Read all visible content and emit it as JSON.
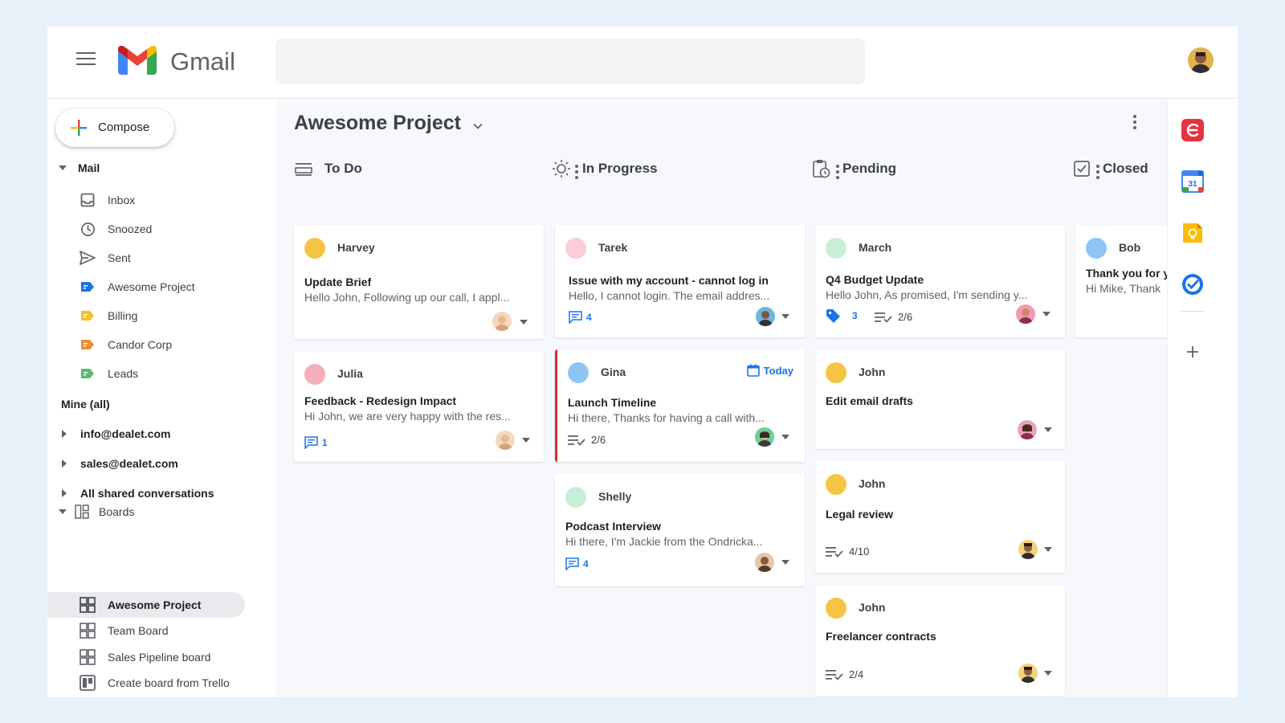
{
  "app": {
    "name": "Gmail"
  },
  "compose": {
    "label": "Compose"
  },
  "sidebar": {
    "mail_header": "Mail",
    "mail_items": [
      {
        "label": "Inbox",
        "icon": "inbox-icon"
      },
      {
        "label": "Snoozed",
        "icon": "clock-icon"
      },
      {
        "label": "Sent",
        "icon": "send-icon"
      },
      {
        "label": "Awesome Project",
        "icon": "label-icon",
        "color": "#1a73e8"
      },
      {
        "label": "Billing",
        "icon": "label-icon",
        "color": "#f6bf26"
      },
      {
        "label": "Candor Corp",
        "icon": "label-icon",
        "color": "#f28b32"
      },
      {
        "label": "Leads",
        "icon": "label-icon",
        "color": "#5bb974"
      }
    ],
    "mine_header": "Mine (all)",
    "accounts": [
      "info@dealet.com",
      "sales@dealet.com",
      "All shared conversations"
    ],
    "boards_header": "Boards",
    "boards": [
      {
        "label": "Awesome Project",
        "active": true
      },
      {
        "label": "Team Board",
        "active": false
      },
      {
        "label": "Sales Pipeline board",
        "active": false
      },
      {
        "label": "Create board from Trello",
        "active": false
      }
    ]
  },
  "board": {
    "title": "Awesome Project",
    "columns": [
      {
        "title": "To Do",
        "icon": "list-icon"
      },
      {
        "title": "In Progress",
        "icon": "sun-icon"
      },
      {
        "title": "Pending",
        "icon": "clipboard-clock-icon"
      },
      {
        "title": "Closed",
        "icon": "checkbox-icon"
      }
    ],
    "cards": {
      "todo": [
        {
          "name": "Harvey",
          "dot": "#f6c444",
          "subject": "Update Brief",
          "preview": "Hello John, Following up our call, I appl..."
        },
        {
          "name": "Julia",
          "dot": "#f6aeb8",
          "subject": "Feedback - Redesign Impact",
          "preview": "Hi John, we are very happy with the res...",
          "comments": "1"
        }
      ],
      "progress": [
        {
          "name": "Tarek",
          "dot": "#fbcdd6",
          "subject": "Issue with my account - cannot log in",
          "preview": "Hello, I cannot login. The email addres...",
          "comments": "4"
        },
        {
          "name": "Gina",
          "dot": "#8ec5f5",
          "subject": "Launch Timeline",
          "preview": "Hi there, Thanks for having a call with...",
          "tasks": "2/6",
          "due": "Today"
        },
        {
          "name": "Shelly",
          "dot": "#c9eed8",
          "subject": "Podcast Interview",
          "preview": "Hi there, I'm Jackie from the Ondricka...",
          "comments": "4"
        }
      ],
      "pending": [
        {
          "name": "March",
          "dot": "#c9eed8",
          "subject": "Q4 Budget Update",
          "preview": "Hello John, As promised, I'm sending y...",
          "tags": "3",
          "tasks": "2/6"
        },
        {
          "name": "John",
          "dot": "#f6c444",
          "subject": "Edit email drafts"
        },
        {
          "name": "John",
          "dot": "#f6c444",
          "subject": "Legal review",
          "tasks": "4/10"
        },
        {
          "name": "John",
          "dot": "#f6c444",
          "subject": "Freelancer contracts",
          "tasks": "2/4"
        }
      ],
      "closed": [
        {
          "name": "Bob",
          "dot": "#8ec5f5",
          "subject": "Thank you for y",
          "preview": "Hi Mike, Thank"
        }
      ]
    }
  },
  "rail": {
    "icons": [
      "dealet-icon",
      "calendar-icon",
      "keep-icon",
      "tasks-icon",
      "add-icon"
    ],
    "calendar_day": "31"
  }
}
